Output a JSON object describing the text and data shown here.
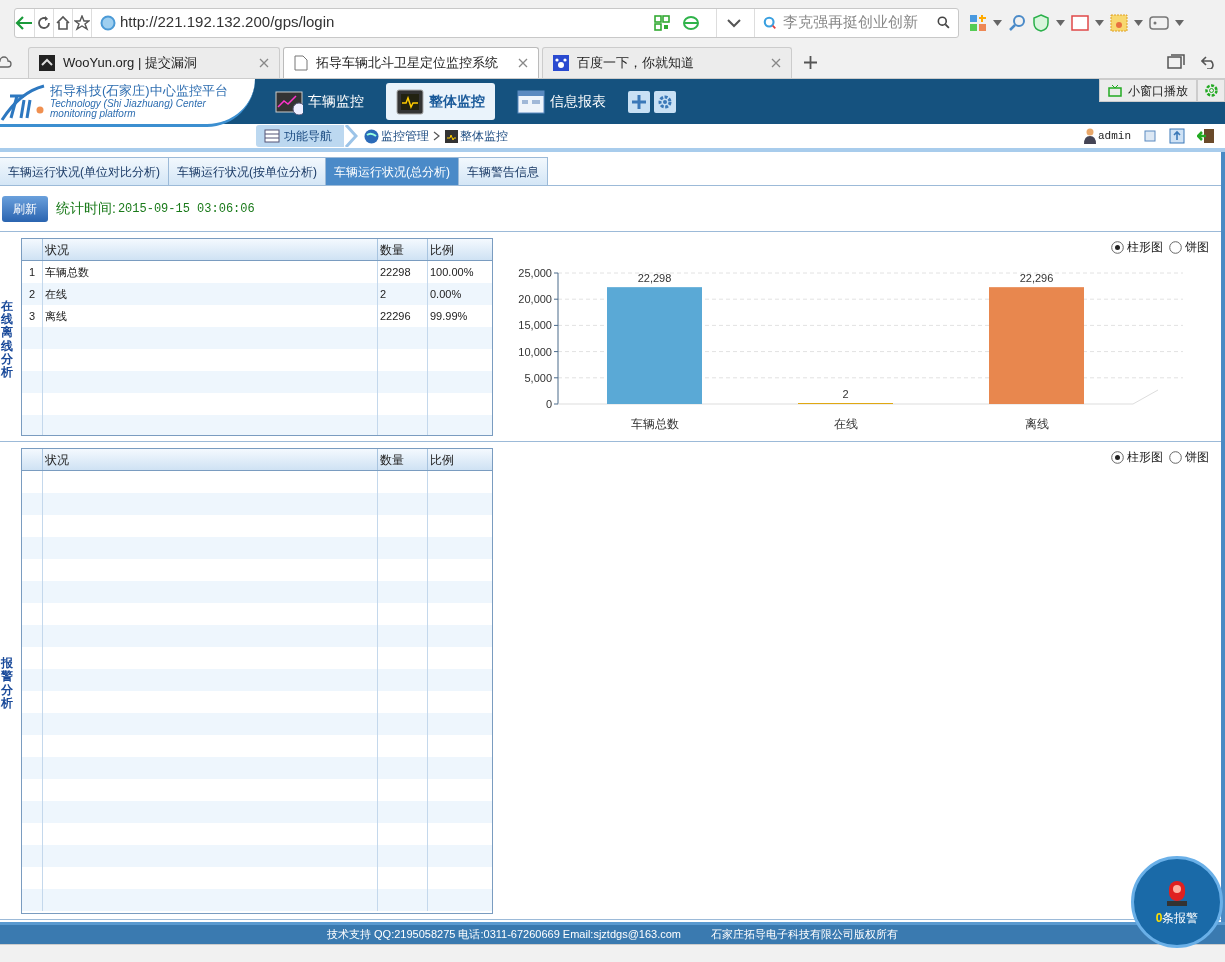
{
  "browser": {
    "url": "http://221.192.132.200/gps/login",
    "search_placeholder": "李克强再挺创业创新",
    "tabs": [
      {
        "label": "WooYun.org | 提交漏洞",
        "selected": false
      },
      {
        "label": "拓导车辆北斗卫星定位监控系统",
        "selected": true
      },
      {
        "label": "百度一下，你就知道",
        "selected": false
      }
    ]
  },
  "header": {
    "logo_title": "拓导科技(石家庄)中心监控平台",
    "logo_subtitle": "Technology (Shi Jiazhuang) Center monitoring platform",
    "nav": [
      {
        "label": "车辆监控",
        "selected": false
      },
      {
        "label": "整体监控",
        "selected": true
      },
      {
        "label": "信息报表",
        "selected": false
      }
    ],
    "mini_window": "小窗口播放"
  },
  "breadcrumb": {
    "nav_button": "功能导航",
    "path": [
      "监控管理",
      "整体监控"
    ],
    "user": "admin"
  },
  "page_tabs": [
    {
      "label": "车辆运行状况(单位对比分析)",
      "selected": false
    },
    {
      "label": "车辆运行状况(按单位分析)",
      "selected": false
    },
    {
      "label": "车辆运行状况(总分析)",
      "selected": true
    },
    {
      "label": "车辆警告信息",
      "selected": false
    }
  ],
  "refresh_button": "刷新",
  "stat_label": "统计时间:",
  "stat_time": "2015-09-15 03:06:06",
  "sections": [
    {
      "title": "在线离线分析",
      "columns": [
        "状况",
        "数量",
        "比例"
      ],
      "rows": [
        {
          "index": "1",
          "status": "车辆总数",
          "count": "22298",
          "ratio": "100.00%"
        },
        {
          "index": "2",
          "status": "在线",
          "count": "2",
          "ratio": "0.00%"
        },
        {
          "index": "3",
          "status": "离线",
          "count": "22296",
          "ratio": "99.99%"
        }
      ],
      "chart_types": [
        {
          "label": "柱形图",
          "selected": true
        },
        {
          "label": "饼图",
          "selected": false
        }
      ],
      "chart_data": {
        "type": "bar",
        "grid": true,
        "categories": [
          "车辆总数",
          "在线",
          "离线"
        ],
        "values": [
          22298,
          2,
          22296
        ],
        "colors": [
          "#5aa9d6",
          "#e0a812",
          "#e8874e"
        ],
        "ylim": [
          0,
          25000
        ],
        "yticks": [
          {
            "value": 0,
            "label": "0"
          },
          {
            "value": 5000,
            "label": "5,000"
          },
          {
            "value": 10000,
            "label": "10,000"
          },
          {
            "value": 15000,
            "label": "15,000"
          },
          {
            "value": 20000,
            "label": "20,000"
          },
          {
            "value": 25000,
            "label": "25,000"
          }
        ],
        "value_labels": [
          "22,298",
          "2",
          "22,296"
        ]
      }
    },
    {
      "title": "报警分析",
      "columns": [
        "状况",
        "数量",
        "比例"
      ],
      "chart_types": [
        {
          "label": "柱形图",
          "selected": true
        },
        {
          "label": "饼图",
          "selected": false
        }
      ]
    }
  ],
  "footer": {
    "support": "技术支持 QQ:2195058275 电话:0311-67260669 Email:sjztdgs@163.com",
    "copyright": "石家庄拓导电子科技有限公司版权所有"
  },
  "alarm": {
    "count": "0",
    "label": "条报警"
  }
}
